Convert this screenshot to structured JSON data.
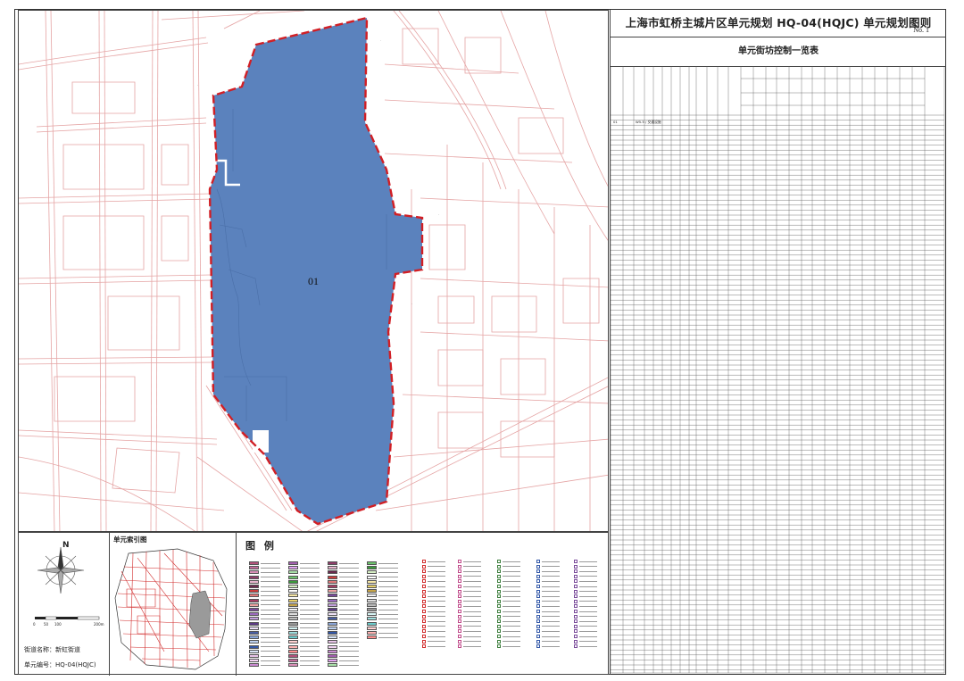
{
  "map": {
    "district_label": "01",
    "fill_color": "#5b82bd",
    "boundary_color": "#d11f25",
    "road_color": "#e5a4a4"
  },
  "header": {
    "title": "上海市虹桥主城片区单元规划   HQ-04(HQJC) 单元规划图则",
    "sheet_no": "No. 1"
  },
  "table": {
    "title": "单元街坊控制一览表",
    "first_row": {
      "code": "01",
      "note": "W5.5 / 交通设施"
    }
  },
  "info": {
    "street": "街道名称：新虹街道",
    "unit": "单元编号：HQ-04(HQJC)"
  },
  "index_map": {
    "title": "单元索引图"
  },
  "legend": {
    "title": "图  例"
  },
  "compass": {
    "north": "N"
  },
  "scale": {
    "labels": [
      "0",
      "50",
      "100",
      "200m"
    ]
  }
}
